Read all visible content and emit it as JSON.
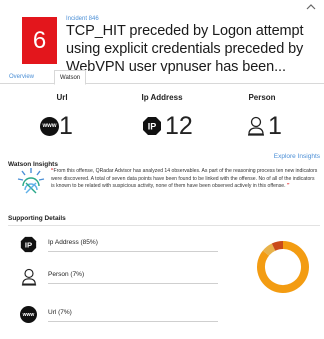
{
  "header": {
    "severity": "6",
    "incident_id": "Incident 846",
    "title": "TCP_HIT preceded by Logon attempt using explicit credentials preceded by WebVPN user vpnuser has been..."
  },
  "tabs": [
    {
      "label": "Overview"
    },
    {
      "label": "Watson"
    }
  ],
  "stats": {
    "url": {
      "label": "Url",
      "value": "1",
      "icon": "www-icon"
    },
    "ip": {
      "label": "Ip Address",
      "value": "12",
      "icon": "ip-icon"
    },
    "person": {
      "label": "Person",
      "value": "1",
      "icon": "person-icon"
    }
  },
  "insights": {
    "title": "Watson Insights",
    "explore_label": "Explore Insights",
    "text": "From this offense, QRadar Advisor has analyzed 14 observables. As part of the reasoning process ten new indicators were discovered. A total of seven data points have been found to be linked with the offense. No of all of the indicators is known to be related with suspicious activity, none of them have been observed actively in this offense."
  },
  "supporting": {
    "title": "Supporting Details",
    "items": [
      {
        "label": "Ip Address (85%)",
        "icon": "ip-icon",
        "share": 0.85
      },
      {
        "label": "Person (7%)",
        "icon": "person-icon",
        "share": 0.07
      },
      {
        "label": "Url (7%)",
        "icon": "www-icon",
        "share": 0.07
      }
    ]
  },
  "colors": {
    "severity": "#e3161c",
    "link": "#4b8fd6",
    "donut_main": "#f39c12",
    "donut_secondary": "#e8b24a",
    "donut_tertiary": "#c94a1a"
  }
}
